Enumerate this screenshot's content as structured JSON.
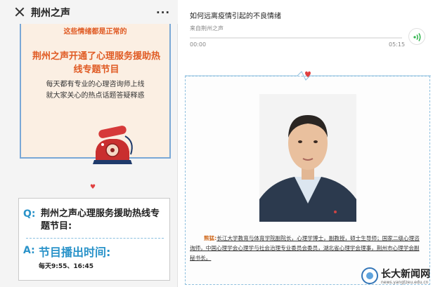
{
  "left_panel": {
    "app_title": "荆州之声",
    "more_label": "···",
    "card1": {
      "normal_text": "这些情绪都是正常的",
      "headline": "荆州之声开通了心理服务援助热线专题节目",
      "sub1": "每天都有专业的心理咨询师上线",
      "sub2": "就大家关心的热点话题答疑释惑"
    },
    "card2": {
      "q_mark": "Q:",
      "question": "荆州之声心理服务援助热线专题节目:",
      "a_mark": "A:",
      "answer": "节目播出时间:",
      "time": "每天9:55、16:45"
    }
  },
  "audio": {
    "title": "如何远离疫情引起的不良情绪",
    "source": "来自荆州之声",
    "start_time": "00:00",
    "end_time": "05:15",
    "progress": 0
  },
  "bio": {
    "name": "熊猛:",
    "body": "长江大学教育与体育学院副院长，心理学博士，副教授，硕士生导师；国家二级心理咨询师，中国心理学会心理学与社会治理专业委员会委员，湖北省心理学会理事，荆州市心理学会副秘书长。"
  },
  "watermark": {
    "name": "长大新闻网",
    "url": "news.yangtzeu.edu.cn"
  },
  "colors": {
    "accent_orange": "#e05b24",
    "accent_blue": "#2a93c9",
    "audio_green": "#2db34a"
  }
}
